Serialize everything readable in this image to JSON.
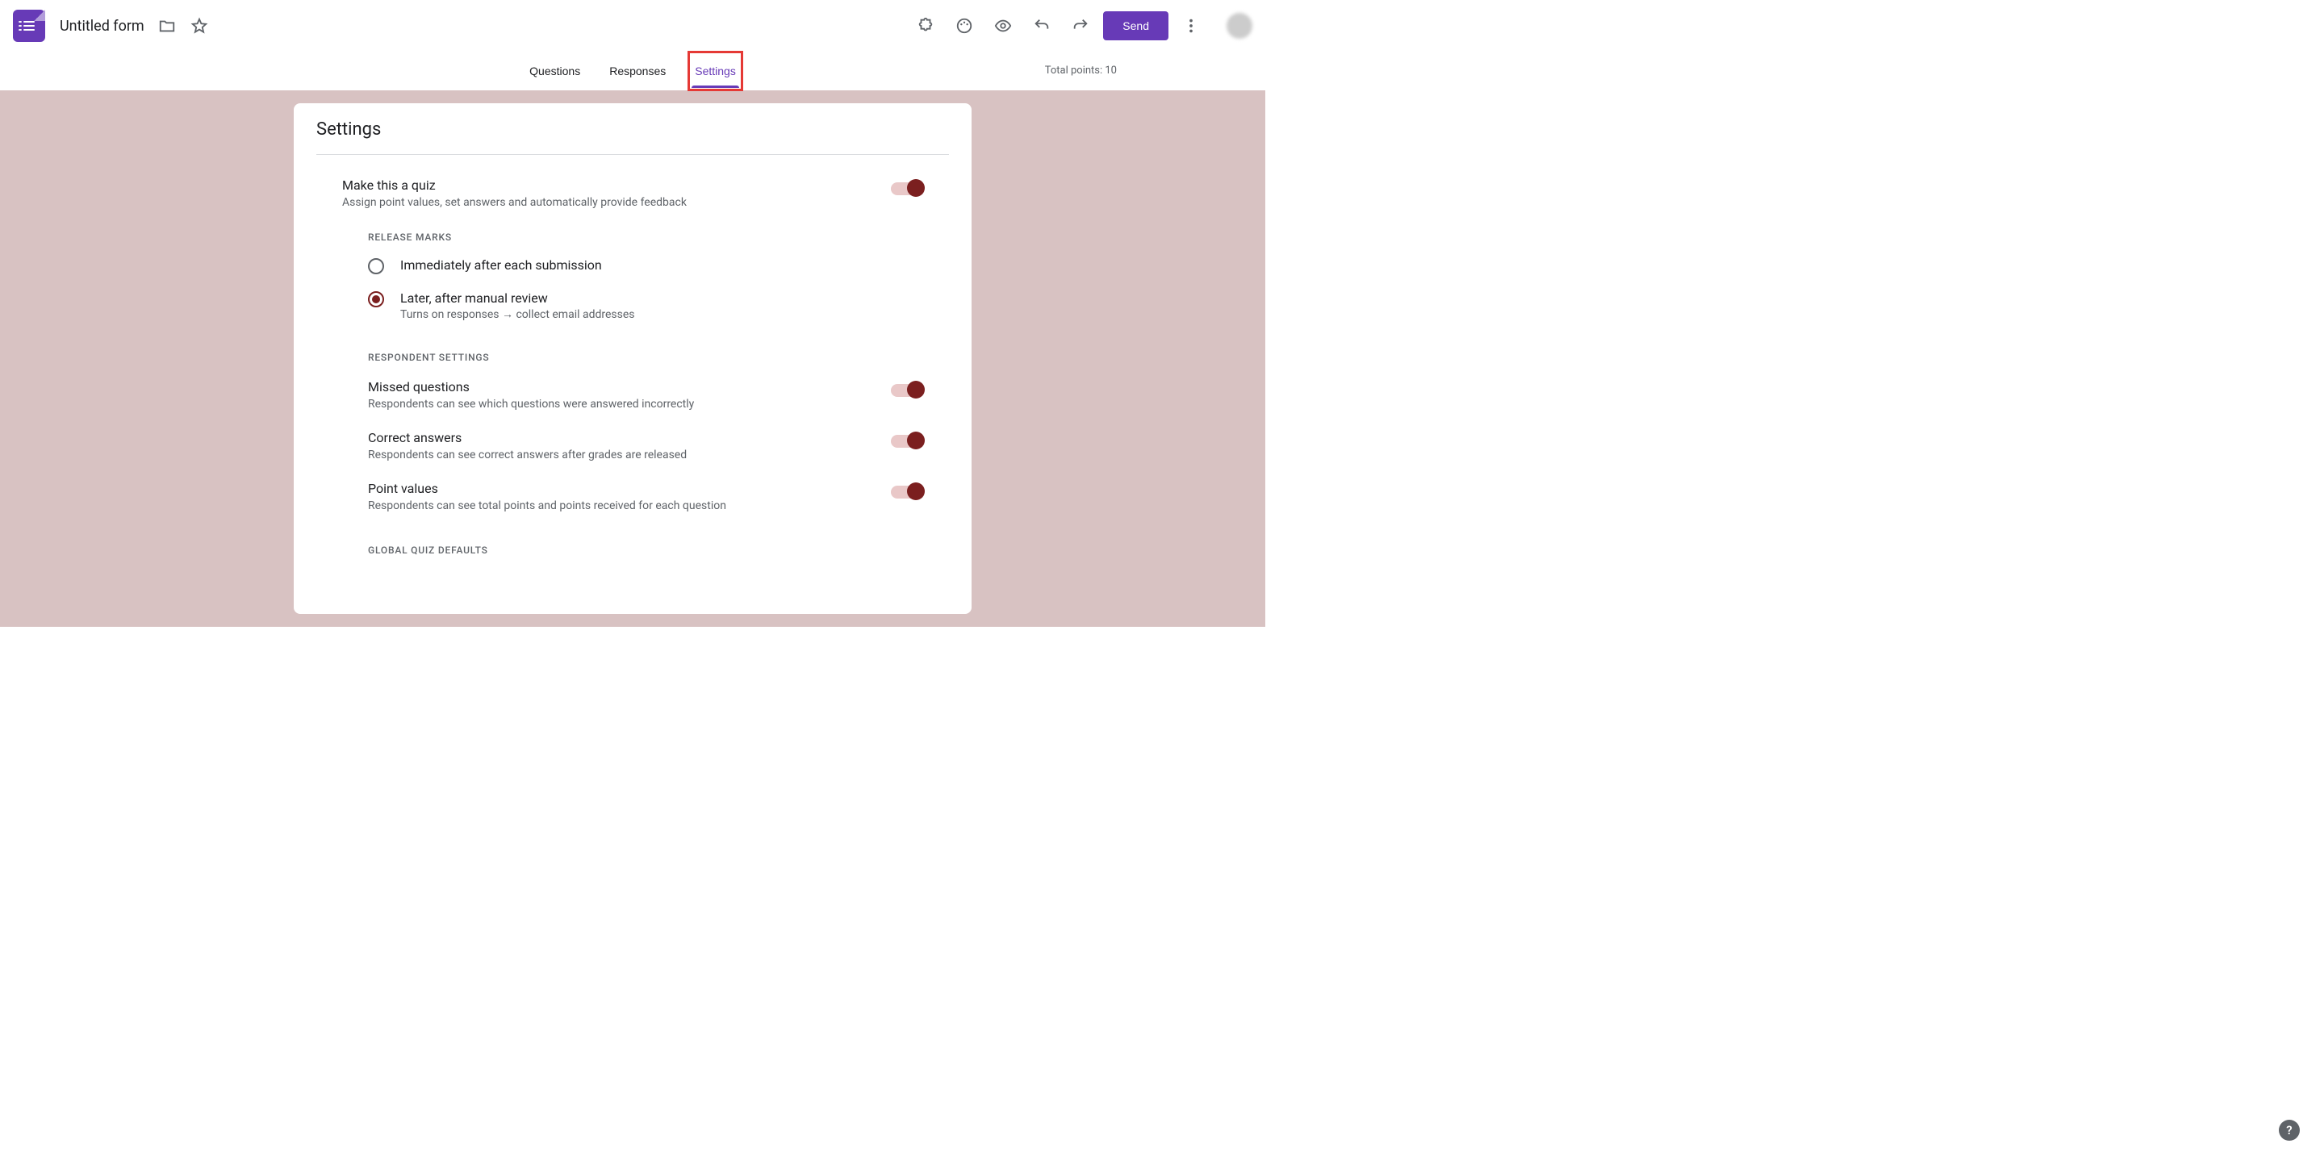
{
  "header": {
    "title": "Untitled form",
    "send_label": "Send",
    "total_points": "Total points: 10"
  },
  "tabs": {
    "questions": "Questions",
    "responses": "Responses",
    "settings": "Settings"
  },
  "card": {
    "title": "Settings",
    "quiz": {
      "title": "Make this a quiz",
      "desc": "Assign point values, set answers and automatically provide feedback"
    },
    "release_header": "RELEASE MARKS",
    "release_opts": {
      "immediate": "Immediately after each submission",
      "later": "Later, after manual review",
      "later_sub": "Turns on responses → collect email addresses"
    },
    "respondent_header": "RESPONDENT SETTINGS",
    "respondent": {
      "missed_t": "Missed questions",
      "missed_d": "Respondents can see which questions were answered incorrectly",
      "correct_t": "Correct answers",
      "correct_d": "Respondents can see correct answers after grades are released",
      "points_t": "Point values",
      "points_d": "Respondents can see total points and points received for each question"
    },
    "global_header": "GLOBAL QUIZ DEFAULTS"
  }
}
